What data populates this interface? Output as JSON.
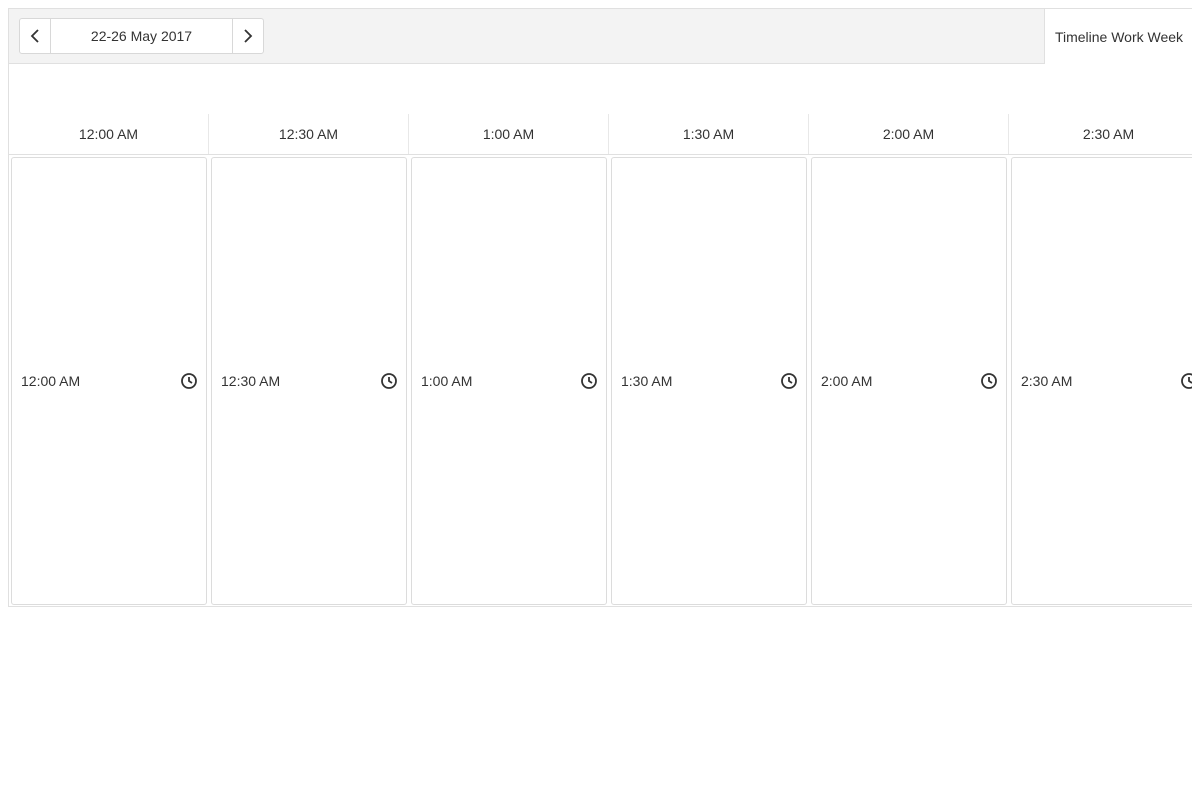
{
  "toolbar": {
    "prev_icon": "chevron-left-icon",
    "next_icon": "chevron-right-icon",
    "date_range": "22-26 May 2017",
    "view_label": "Timeline Work Week"
  },
  "time_header": [
    "12:00 AM",
    "12:30 AM",
    "1:00 AM",
    "1:30 AM",
    "2:00 AM",
    "2:30 AM"
  ],
  "slots": [
    {
      "time": "12:00 AM",
      "icon": "clock-icon"
    },
    {
      "time": "12:30 AM",
      "icon": "clock-icon"
    },
    {
      "time": "1:00 AM",
      "icon": "clock-icon"
    },
    {
      "time": "1:30 AM",
      "icon": "clock-icon"
    },
    {
      "time": "2:00 AM",
      "icon": "clock-icon"
    },
    {
      "time": "2:30 AM",
      "icon": "clock-icon"
    }
  ],
  "colors": {
    "toolbar_bg": "#f3f3f3",
    "border": "#e0e0e0",
    "text": "#333333"
  }
}
